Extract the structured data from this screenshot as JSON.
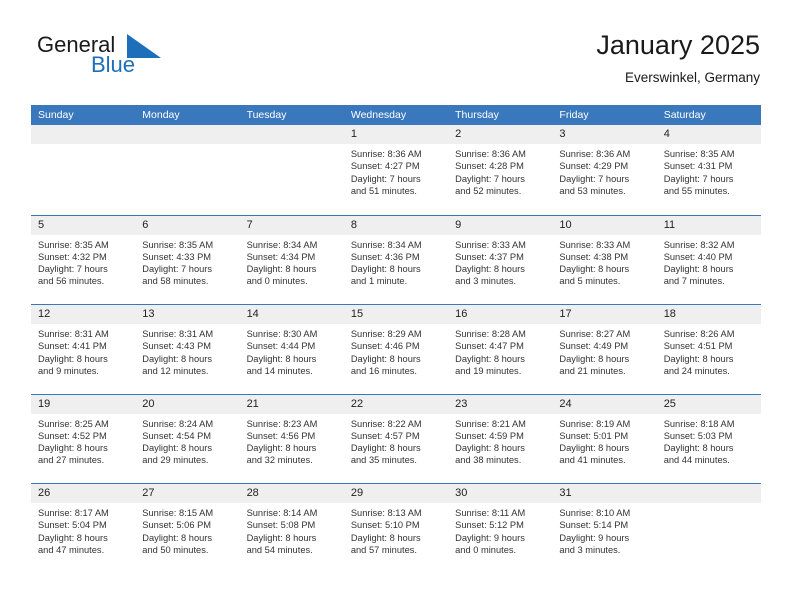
{
  "brand": {
    "name_part1": "General",
    "name_part2": "Blue",
    "flag_icon": "blue-flag-triangle",
    "accent_color": "#1e6fba"
  },
  "header": {
    "title": "January 2025",
    "subtitle": "Everswinkel, Germany"
  },
  "colors": {
    "header_blue": "#3a78bd",
    "day_strip_gray": "#efefef",
    "text": "#333333"
  },
  "calendar": {
    "weekdays": [
      "Sunday",
      "Monday",
      "Tuesday",
      "Wednesday",
      "Thursday",
      "Friday",
      "Saturday"
    ],
    "weeks": [
      [
        {
          "day": "",
          "empty": true
        },
        {
          "day": "",
          "empty": true
        },
        {
          "day": "",
          "empty": true
        },
        {
          "day": "1",
          "sunrise": "Sunrise: 8:36 AM",
          "sunset": "Sunset: 4:27 PM",
          "daylight_line1": "Daylight: 7 hours",
          "daylight_line2": "and 51 minutes."
        },
        {
          "day": "2",
          "sunrise": "Sunrise: 8:36 AM",
          "sunset": "Sunset: 4:28 PM",
          "daylight_line1": "Daylight: 7 hours",
          "daylight_line2": "and 52 minutes."
        },
        {
          "day": "3",
          "sunrise": "Sunrise: 8:36 AM",
          "sunset": "Sunset: 4:29 PM",
          "daylight_line1": "Daylight: 7 hours",
          "daylight_line2": "and 53 minutes."
        },
        {
          "day": "4",
          "sunrise": "Sunrise: 8:35 AM",
          "sunset": "Sunset: 4:31 PM",
          "daylight_line1": "Daylight: 7 hours",
          "daylight_line2": "and 55 minutes."
        }
      ],
      [
        {
          "day": "5",
          "sunrise": "Sunrise: 8:35 AM",
          "sunset": "Sunset: 4:32 PM",
          "daylight_line1": "Daylight: 7 hours",
          "daylight_line2": "and 56 minutes."
        },
        {
          "day": "6",
          "sunrise": "Sunrise: 8:35 AM",
          "sunset": "Sunset: 4:33 PM",
          "daylight_line1": "Daylight: 7 hours",
          "daylight_line2": "and 58 minutes."
        },
        {
          "day": "7",
          "sunrise": "Sunrise: 8:34 AM",
          "sunset": "Sunset: 4:34 PM",
          "daylight_line1": "Daylight: 8 hours",
          "daylight_line2": "and 0 minutes."
        },
        {
          "day": "8",
          "sunrise": "Sunrise: 8:34 AM",
          "sunset": "Sunset: 4:36 PM",
          "daylight_line1": "Daylight: 8 hours",
          "daylight_line2": "and 1 minute."
        },
        {
          "day": "9",
          "sunrise": "Sunrise: 8:33 AM",
          "sunset": "Sunset: 4:37 PM",
          "daylight_line1": "Daylight: 8 hours",
          "daylight_line2": "and 3 minutes."
        },
        {
          "day": "10",
          "sunrise": "Sunrise: 8:33 AM",
          "sunset": "Sunset: 4:38 PM",
          "daylight_line1": "Daylight: 8 hours",
          "daylight_line2": "and 5 minutes."
        },
        {
          "day": "11",
          "sunrise": "Sunrise: 8:32 AM",
          "sunset": "Sunset: 4:40 PM",
          "daylight_line1": "Daylight: 8 hours",
          "daylight_line2": "and 7 minutes."
        }
      ],
      [
        {
          "day": "12",
          "sunrise": "Sunrise: 8:31 AM",
          "sunset": "Sunset: 4:41 PM",
          "daylight_line1": "Daylight: 8 hours",
          "daylight_line2": "and 9 minutes."
        },
        {
          "day": "13",
          "sunrise": "Sunrise: 8:31 AM",
          "sunset": "Sunset: 4:43 PM",
          "daylight_line1": "Daylight: 8 hours",
          "daylight_line2": "and 12 minutes."
        },
        {
          "day": "14",
          "sunrise": "Sunrise: 8:30 AM",
          "sunset": "Sunset: 4:44 PM",
          "daylight_line1": "Daylight: 8 hours",
          "daylight_line2": "and 14 minutes."
        },
        {
          "day": "15",
          "sunrise": "Sunrise: 8:29 AM",
          "sunset": "Sunset: 4:46 PM",
          "daylight_line1": "Daylight: 8 hours",
          "daylight_line2": "and 16 minutes."
        },
        {
          "day": "16",
          "sunrise": "Sunrise: 8:28 AM",
          "sunset": "Sunset: 4:47 PM",
          "daylight_line1": "Daylight: 8 hours",
          "daylight_line2": "and 19 minutes."
        },
        {
          "day": "17",
          "sunrise": "Sunrise: 8:27 AM",
          "sunset": "Sunset: 4:49 PM",
          "daylight_line1": "Daylight: 8 hours",
          "daylight_line2": "and 21 minutes."
        },
        {
          "day": "18",
          "sunrise": "Sunrise: 8:26 AM",
          "sunset": "Sunset: 4:51 PM",
          "daylight_line1": "Daylight: 8 hours",
          "daylight_line2": "and 24 minutes."
        }
      ],
      [
        {
          "day": "19",
          "sunrise": "Sunrise: 8:25 AM",
          "sunset": "Sunset: 4:52 PM",
          "daylight_line1": "Daylight: 8 hours",
          "daylight_line2": "and 27 minutes."
        },
        {
          "day": "20",
          "sunrise": "Sunrise: 8:24 AM",
          "sunset": "Sunset: 4:54 PM",
          "daylight_line1": "Daylight: 8 hours",
          "daylight_line2": "and 29 minutes."
        },
        {
          "day": "21",
          "sunrise": "Sunrise: 8:23 AM",
          "sunset": "Sunset: 4:56 PM",
          "daylight_line1": "Daylight: 8 hours",
          "daylight_line2": "and 32 minutes."
        },
        {
          "day": "22",
          "sunrise": "Sunrise: 8:22 AM",
          "sunset": "Sunset: 4:57 PM",
          "daylight_line1": "Daylight: 8 hours",
          "daylight_line2": "and 35 minutes."
        },
        {
          "day": "23",
          "sunrise": "Sunrise: 8:21 AM",
          "sunset": "Sunset: 4:59 PM",
          "daylight_line1": "Daylight: 8 hours",
          "daylight_line2": "and 38 minutes."
        },
        {
          "day": "24",
          "sunrise": "Sunrise: 8:19 AM",
          "sunset": "Sunset: 5:01 PM",
          "daylight_line1": "Daylight: 8 hours",
          "daylight_line2": "and 41 minutes."
        },
        {
          "day": "25",
          "sunrise": "Sunrise: 8:18 AM",
          "sunset": "Sunset: 5:03 PM",
          "daylight_line1": "Daylight: 8 hours",
          "daylight_line2": "and 44 minutes."
        }
      ],
      [
        {
          "day": "26",
          "sunrise": "Sunrise: 8:17 AM",
          "sunset": "Sunset: 5:04 PM",
          "daylight_line1": "Daylight: 8 hours",
          "daylight_line2": "and 47 minutes."
        },
        {
          "day": "27",
          "sunrise": "Sunrise: 8:15 AM",
          "sunset": "Sunset: 5:06 PM",
          "daylight_line1": "Daylight: 8 hours",
          "daylight_line2": "and 50 minutes."
        },
        {
          "day": "28",
          "sunrise": "Sunrise: 8:14 AM",
          "sunset": "Sunset: 5:08 PM",
          "daylight_line1": "Daylight: 8 hours",
          "daylight_line2": "and 54 minutes."
        },
        {
          "day": "29",
          "sunrise": "Sunrise: 8:13 AM",
          "sunset": "Sunset: 5:10 PM",
          "daylight_line1": "Daylight: 8 hours",
          "daylight_line2": "and 57 minutes."
        },
        {
          "day": "30",
          "sunrise": "Sunrise: 8:11 AM",
          "sunset": "Sunset: 5:12 PM",
          "daylight_line1": "Daylight: 9 hours",
          "daylight_line2": "and 0 minutes."
        },
        {
          "day": "31",
          "sunrise": "Sunrise: 8:10 AM",
          "sunset": "Sunset: 5:14 PM",
          "daylight_line1": "Daylight: 9 hours",
          "daylight_line2": "and 3 minutes."
        },
        {
          "day": "",
          "empty": true
        }
      ]
    ]
  }
}
